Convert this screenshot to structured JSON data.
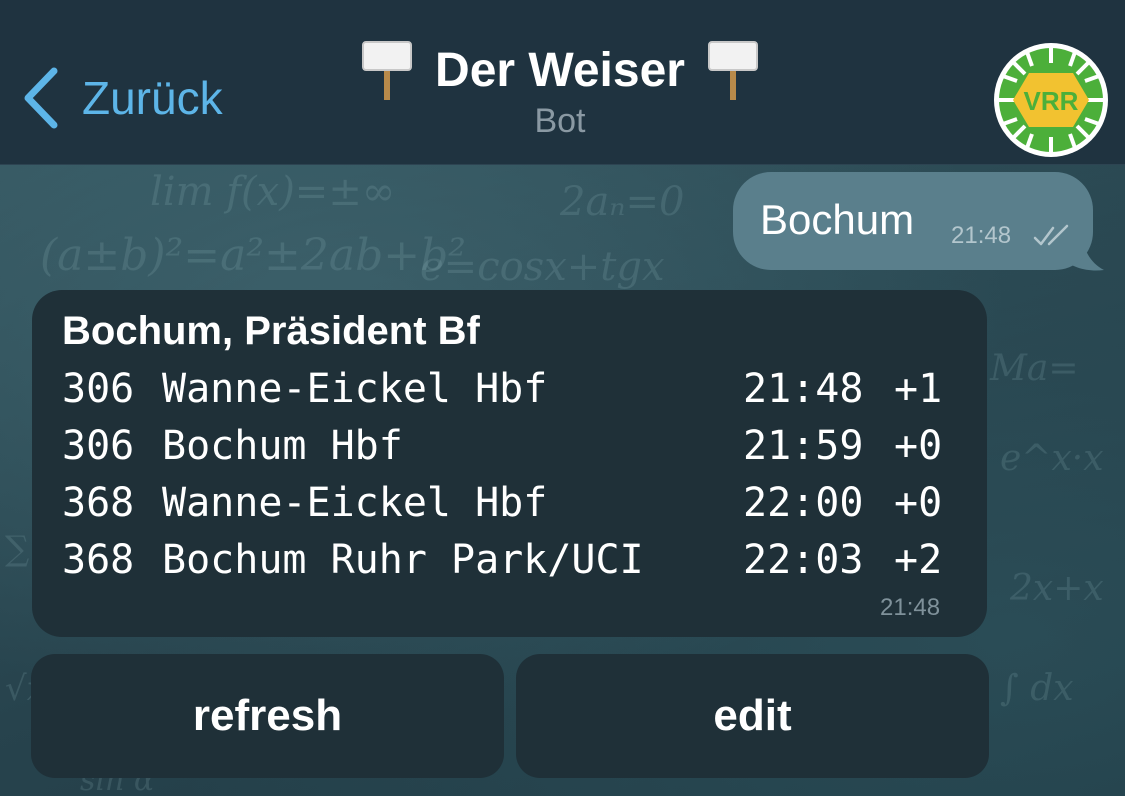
{
  "header": {
    "back_label": "Zurück",
    "title": "Der Weiser",
    "subtitle": "Bot",
    "avatar_text": "VRR",
    "colors": {
      "back": "#5db5e8",
      "header_bg": "#1f3340",
      "avatar_green": "#4caf3a",
      "avatar_yellow": "#f2c230"
    }
  },
  "messages": {
    "outgoing": {
      "text": "Bochum",
      "time": "21:48",
      "status": "double-check-icon"
    },
    "incoming": {
      "stop": "Bochum, Präsident Bf",
      "departures": [
        {
          "line": "306",
          "destination": "Wanne-Eickel Hbf",
          "time": "21:48",
          "delay": "+1"
        },
        {
          "line": "306",
          "destination": "Bochum Hbf",
          "time": "21:59",
          "delay": "+0"
        },
        {
          "line": "368",
          "destination": "Wanne-Eickel Hbf",
          "time": "22:00",
          "delay": "+0"
        },
        {
          "line": "368",
          "destination": "Bochum Ruhr Park/UCI",
          "time": "22:03",
          "delay": "+2"
        }
      ],
      "time": "21:48"
    }
  },
  "keyboard": {
    "refresh_label": "refresh",
    "edit_label": "edit"
  }
}
